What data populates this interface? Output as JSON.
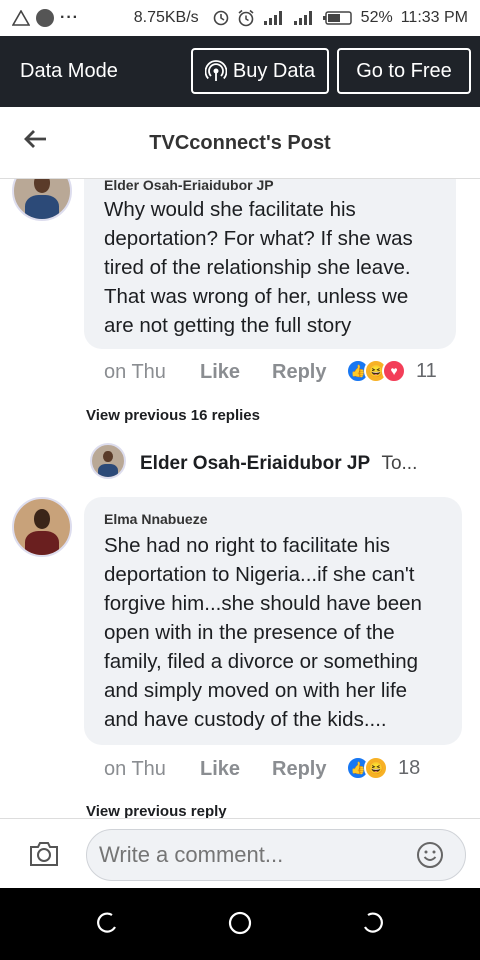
{
  "status_bar": {
    "left_icons": [
      "warning-triangle-icon",
      "circle-icon",
      "more-dots-icon"
    ],
    "network_speed": "8.75KB/s",
    "battery": "52%",
    "time": "11:33 PM"
  },
  "data_bar": {
    "title": "Data Mode",
    "buy_data": "Buy Data",
    "go_free": "Go to Free"
  },
  "header": {
    "title": "TVCconnect's Post"
  },
  "comments": [
    {
      "author": "Elder Osah-Eriaidubor JP",
      "text": "Why would she facilitate his deportation? For what? If she was tired of the relationship she leave. That was wrong of her, unless we are not getting the full story",
      "time": "on Thu",
      "like": "Like",
      "reply": "Reply",
      "reactions": [
        "like",
        "haha",
        "love"
      ],
      "reaction_count": "11"
    },
    {
      "author": "Elma Nnabueze",
      "text": "She had no right to facilitate his deportation to Nigeria...if she can't forgive him...she should have been open with in the presence of the family, filed a divorce or something and simply moved on with her life and have custody of the kids....",
      "time": "on Thu",
      "like": "Like",
      "reply": "Reply",
      "reactions": [
        "like",
        "haha"
      ],
      "reaction_count": "18"
    }
  ],
  "view_previous_replies": "View previous 16 replies",
  "reply_preview": {
    "author": "Elder Osah-Eriaidubor JP",
    "snippet": "To..."
  },
  "view_previous_reply": "View previous reply",
  "composer": {
    "placeholder": "Write a comment..."
  },
  "nav_bar": {
    "icons": [
      "recent-apps-icon",
      "home-icon",
      "back-icon"
    ]
  }
}
